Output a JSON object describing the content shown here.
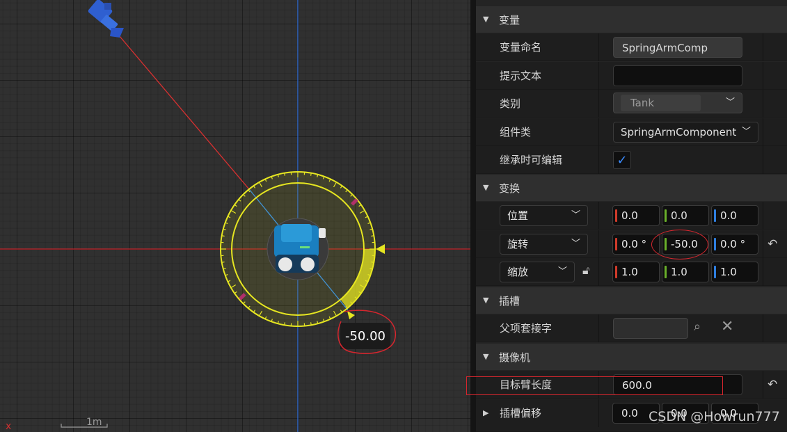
{
  "viewport": {
    "angle_readout": "-50.00",
    "scale_label": "1m",
    "origin_axis_mark": "x"
  },
  "details": {
    "sections": {
      "variable": "变量",
      "transform": "变换",
      "socket": "插槽",
      "camera": "摄像机"
    },
    "variable": {
      "name_label": "变量命名",
      "name_value": "SpringArmComp",
      "tooltip_label": "提示文本",
      "tooltip_value": "",
      "category_label": "类别",
      "category_value": "Tank",
      "component_class_label": "组件类",
      "component_class_value": "SpringArmComponent",
      "editable_inherit_label": "继承时可编辑",
      "editable_inherit_checked": true
    },
    "transform": {
      "location_label": "位置",
      "location": [
        "0.0",
        "0.0",
        "0.0"
      ],
      "rotation_label": "旋转",
      "rotation": [
        "0.0 °",
        "-50.0",
        "0.0 °"
      ],
      "scale_label": "缩放",
      "scale": [
        "1.0",
        "1.0",
        "1.0"
      ]
    },
    "socket": {
      "parent_socket_label": "父项套接字",
      "parent_socket_value": ""
    },
    "camera": {
      "target_arm_length_label": "目标臂长度",
      "target_arm_length_value": "600.0",
      "socket_offset_label": "插槽偏移",
      "socket_offset": [
        "0.0",
        "0.0",
        "0.0"
      ]
    }
  },
  "watermark": "CSDN @Howrun777",
  "colors": {
    "accent_blue": "#3b8cff",
    "annotation_red": "#d6262e",
    "gizmo_yellow": "#e6e621",
    "axis_x_red": "#d03a2a",
    "axis_y_green": "#6ab02a",
    "axis_z_blue": "#2f7fe0"
  }
}
